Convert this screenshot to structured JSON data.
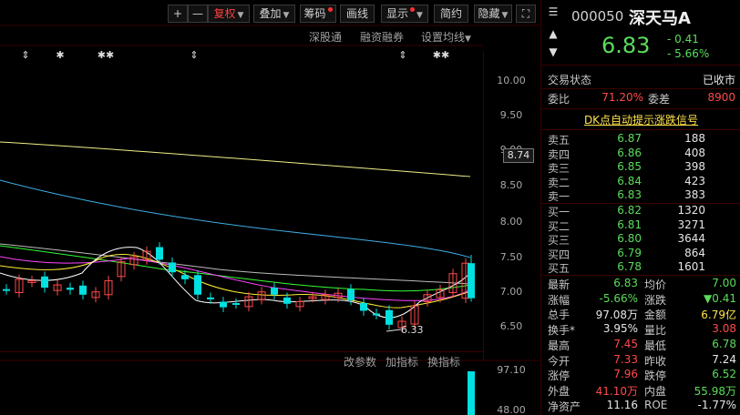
{
  "toolbar": {
    "plus": "+",
    "minus": "—",
    "fuquan": "复权",
    "diejia": "叠加",
    "chouma": "筹码",
    "huaxian": "画线",
    "xianshi": "显示",
    "jianyue": "简约",
    "yincang": "隐藏",
    "fullscreen": "⛶"
  },
  "sub_toolbar": {
    "shengutong": "深股通",
    "rongzi": "融资融券",
    "ma_setting": "设置均线"
  },
  "markers": [
    "⇕",
    "✱",
    "✱✱",
    "⇕",
    "⇕",
    "✱✱"
  ],
  "price_axis": {
    "ticks": [
      "10.00",
      "9.50",
      "9.00",
      "8.50",
      "8.00",
      "7.50",
      "7.00",
      "6.50"
    ],
    "current_price_tag": "8.74",
    "low_label": "6.33"
  },
  "indicator_bar": {
    "gai_canshu": "改参数",
    "jia_zhibiao": "加指标",
    "huan_zhibiao": "换指标"
  },
  "volume_axis": {
    "ticks": [
      "97.10",
      "48.00"
    ]
  },
  "colors": {
    "up": "#ff4a4a",
    "down": "#00e0e0",
    "ma5": "#ffffff",
    "ma10": "#ffee33",
    "ma20": "#ff44ff",
    "ma30": "#33ff33",
    "ma60": "#bcbcbc",
    "ma120": "#3fb0e8",
    "ma250": "#f0f088"
  },
  "chart_data": {
    "type": "candlestick",
    "ylim": [
      6.3,
      10.1
    ],
    "close_approx": [
      6.95,
      7.1,
      7.08,
      6.98,
      7.02,
      6.95,
      6.88,
      6.92,
      7.08,
      7.35,
      7.42,
      7.5,
      7.38,
      7.2,
      7.1,
      6.88,
      6.82,
      6.7,
      6.75,
      6.85,
      6.92,
      6.88,
      6.75,
      6.78,
      6.85,
      6.88,
      6.9,
      6.8,
      6.65,
      6.6,
      6.45,
      6.5,
      6.72,
      6.88,
      6.95,
      7.18,
      7.33
    ]
  },
  "quote": {
    "code": "000050",
    "name": "深天马A",
    "price": "6.83",
    "change": "- 0.41",
    "change_pct": "- 5.66%",
    "trade_status_label": "交易状态",
    "trade_status_value": "已收市",
    "weibi_label": "委比",
    "weibi_value": "71.20%",
    "weicha_label": "委差",
    "weicha_value": "8900",
    "dk_link": "DK点自动提示涨跌信号",
    "asks": [
      {
        "label": "卖五",
        "price": "6.87",
        "vol": "188"
      },
      {
        "label": "卖四",
        "price": "6.86",
        "vol": "408"
      },
      {
        "label": "卖三",
        "price": "6.85",
        "vol": "398"
      },
      {
        "label": "卖二",
        "price": "6.84",
        "vol": "423"
      },
      {
        "label": "卖一",
        "price": "6.83",
        "vol": "383"
      }
    ],
    "bids": [
      {
        "label": "买一",
        "price": "6.82",
        "vol": "1320"
      },
      {
        "label": "买二",
        "price": "6.81",
        "vol": "3271"
      },
      {
        "label": "买三",
        "price": "6.80",
        "vol": "3644"
      },
      {
        "label": "买四",
        "price": "6.79",
        "vol": "864"
      },
      {
        "label": "买五",
        "price": "6.78",
        "vol": "1601"
      }
    ],
    "stats": [
      {
        "l1": "最新",
        "v1": "6.83",
        "c1": "green",
        "l2": "均价",
        "v2": "7.00",
        "c2": "green"
      },
      {
        "l1": "涨幅",
        "v1": "-5.66%",
        "c1": "green",
        "l2": "涨跌",
        "v2": "▼0.41",
        "c2": "green"
      },
      {
        "l1": "总手",
        "v1": "97.08万",
        "c1": "white",
        "l2": "金额",
        "v2": "6.79亿",
        "c2": "yellow"
      },
      {
        "l1": "换手*",
        "v1": "3.95%",
        "c1": "white",
        "l2": "量比",
        "v2": "3.08",
        "c2": "red"
      },
      {
        "l1": "最高",
        "v1": "7.45",
        "c1": "red",
        "l2": "最低",
        "v2": "6.78",
        "c2": "green"
      },
      {
        "l1": "今开",
        "v1": "7.33",
        "c1": "red",
        "l2": "昨收",
        "v2": "7.24",
        "c2": "white"
      },
      {
        "l1": "涨停",
        "v1": "7.96",
        "c1": "red",
        "l2": "跌停",
        "v2": "6.52",
        "c2": "green"
      },
      {
        "l1": "外盘",
        "v1": "41.10万",
        "c1": "red",
        "l2": "内盘",
        "v2": "55.98万",
        "c2": "green"
      },
      {
        "l1": "净资产",
        "v1": "11.16",
        "c1": "white",
        "l2": "ROE",
        "v2": "-1.77%",
        "c2": "white"
      }
    ]
  }
}
